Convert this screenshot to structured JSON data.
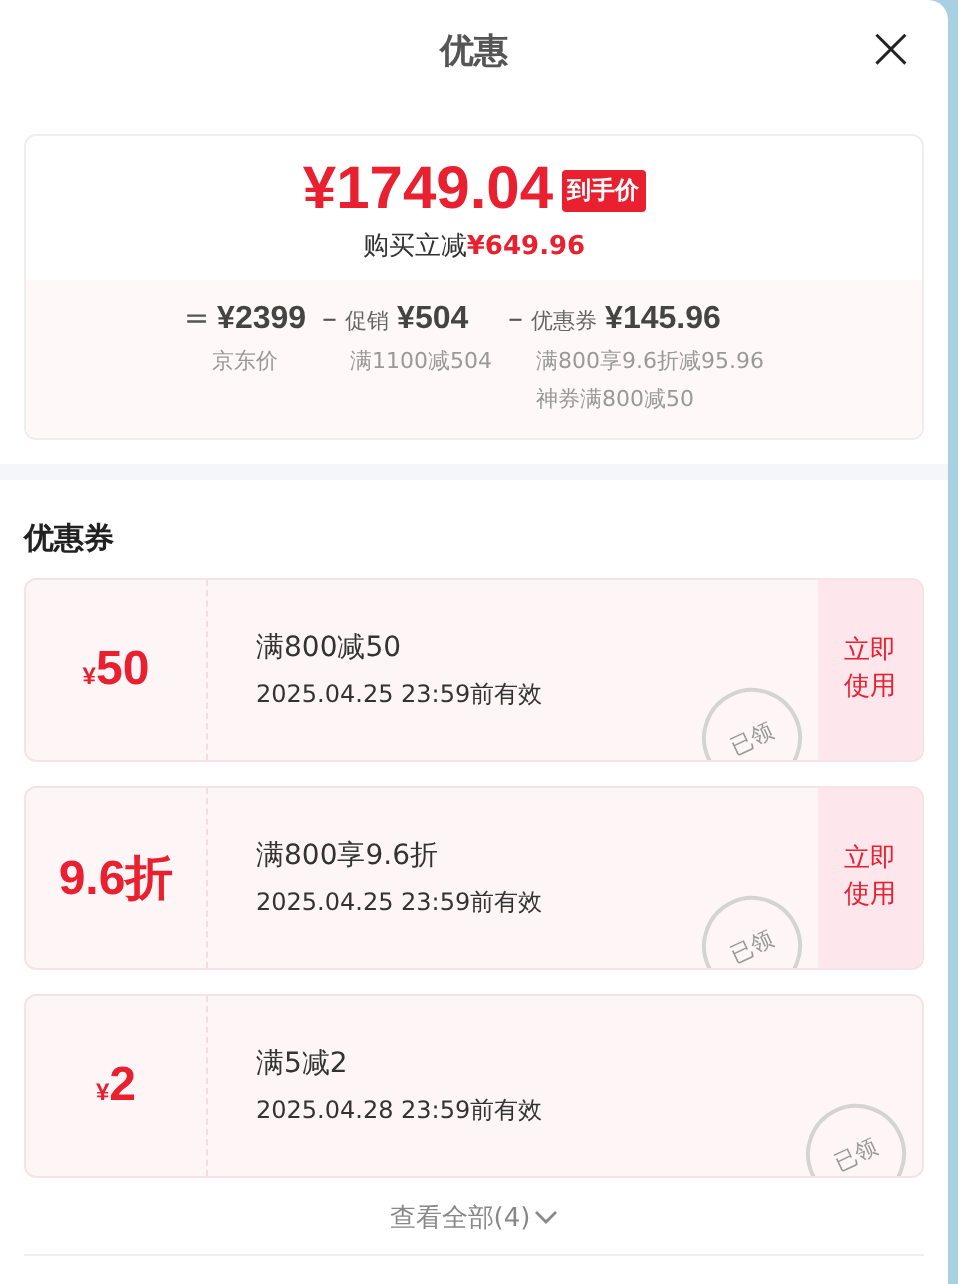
{
  "header": {
    "title": "优惠",
    "close": "×"
  },
  "price_card": {
    "final_price": "¥1749.04",
    "final_tag": "到手价",
    "saving_label": "购买立减",
    "saving_amount": "¥649.96",
    "breakdown": [
      {
        "operator": "=",
        "amount": "¥2399",
        "notes": [
          "京东价"
        ]
      },
      {
        "operator": "–",
        "label": "促销",
        "amount": "¥504",
        "notes": [
          "满1100减504"
        ]
      },
      {
        "operator": "–",
        "label": "优惠券",
        "amount": "¥145.96",
        "notes": [
          "满800享9.6折减95.96",
          "神券满800减50"
        ]
      }
    ]
  },
  "coupons_section": {
    "title": "优惠券",
    "coupons": [
      {
        "kind": "cash",
        "symbol": "¥",
        "value": "50",
        "title": "满800减50",
        "validity": "2025.04.25 23:59前有效",
        "stamp": "已领",
        "claimed": true,
        "action": "立即使用"
      },
      {
        "kind": "discount",
        "value": "9.6折",
        "title": "满800享9.6折",
        "validity": "2025.04.25 23:59前有效",
        "stamp": "已领",
        "claimed": true,
        "action": "立即使用"
      },
      {
        "kind": "cash",
        "symbol": "¥",
        "value": "2",
        "title": "满5减2",
        "validity": "2025.04.28 23:59前有效",
        "stamp": "已领",
        "claimed": true
      }
    ],
    "view_all": "查看全部(4)"
  }
}
